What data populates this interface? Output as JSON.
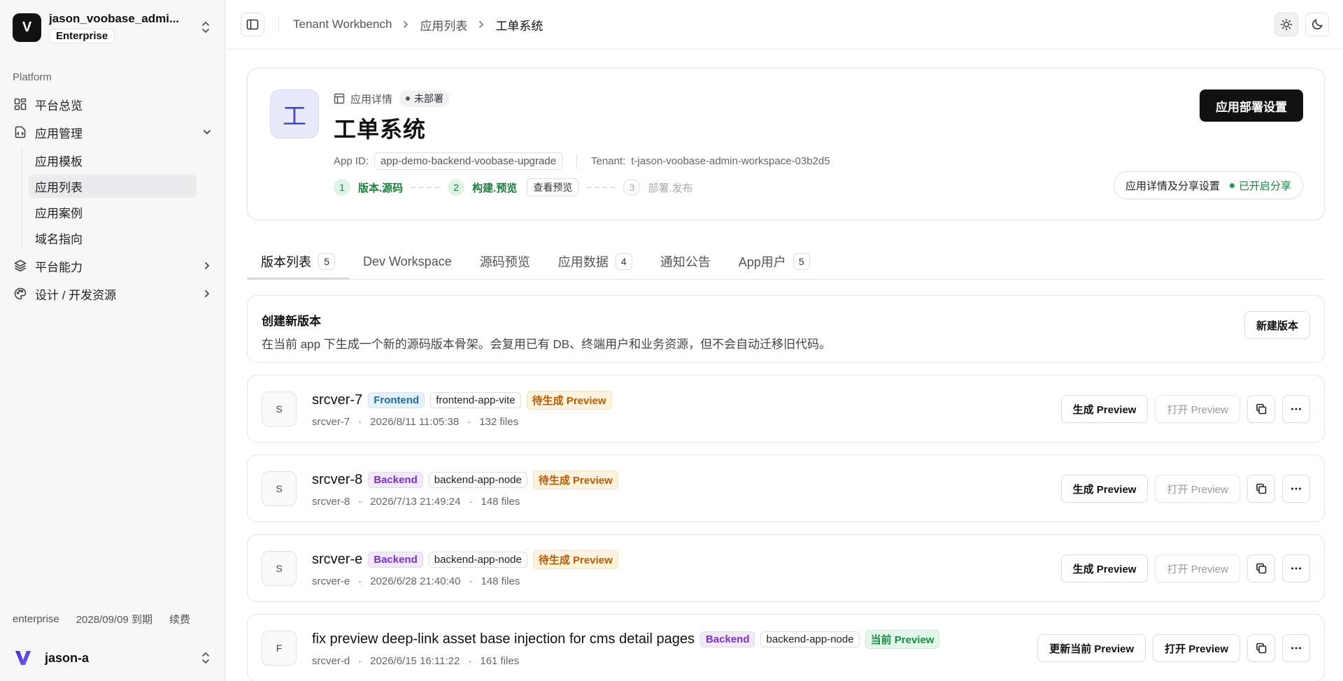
{
  "workspace": {
    "initial": "V",
    "name": "jason_voobase_admi...",
    "plan": "Enterprise"
  },
  "sidebar": {
    "section": "Platform",
    "items": [
      {
        "label": "平台总览",
        "icon": "dashboard-icon"
      },
      {
        "label": "应用管理",
        "icon": "app-manage-icon",
        "expanded": true,
        "children": [
          "应用模板",
          "应用列表",
          "应用案例",
          "域名指向"
        ],
        "active_child": "应用列表"
      },
      {
        "label": "平台能力",
        "icon": "layers-icon"
      },
      {
        "label": "设计 / 开发资源",
        "icon": "palette-icon"
      }
    ],
    "license": {
      "edition": "enterprise",
      "expiry": "2028/09/09 到期",
      "renew": "续费"
    },
    "user": {
      "name": "jason-a"
    }
  },
  "breadcrumb": [
    "Tenant Workbench",
    "应用列表",
    "工单系统"
  ],
  "app": {
    "avatar": "工",
    "meta_label": "应用详情",
    "status": "未部署",
    "title": "工单系统",
    "app_id_label": "App ID:",
    "app_id": "app-demo-backend-voobase-upgrade",
    "tenant_label": "Tenant:",
    "tenant": "t-jason-voobase-admin-workspace-03b2d5",
    "steps": [
      {
        "num": "1",
        "label": "版本.源码",
        "state": "done"
      },
      {
        "num": "2",
        "label": "构建.预览",
        "state": "done"
      },
      {
        "num": "3",
        "label": "部署.发布",
        "state": "todo"
      }
    ],
    "view_preview": "查看预览",
    "deploy_settings": "应用部署设置",
    "share_settings": "应用详情及分享设置",
    "share_status": "已开启分享"
  },
  "tabs": [
    {
      "label": "版本列表",
      "count": "5",
      "active": true
    },
    {
      "label": "Dev Workspace"
    },
    {
      "label": "源码预览"
    },
    {
      "label": "应用数据",
      "count": "4"
    },
    {
      "label": "通知公告"
    },
    {
      "label": "App用户",
      "count": "5"
    }
  ],
  "create": {
    "title": "创建新版本",
    "desc": "在当前 app 下生成一个新的源码版本骨架。会复用已有 DB、终端用户和业务资源，但不会自动迁移旧代码。",
    "button": "新建版本"
  },
  "versions": [
    {
      "avatar": "S",
      "name": "srcver-7",
      "type": "Frontend",
      "template": "frontend-app-vite",
      "preview": "待生成 Preview",
      "id": "srcver-7",
      "time": "2026/8/11 11:05:38",
      "files": "132 files",
      "primary": "生成 Preview",
      "secondary": "打开 Preview"
    },
    {
      "avatar": "S",
      "name": "srcver-8",
      "type": "Backend",
      "template": "backend-app-node",
      "preview": "待生成 Preview",
      "id": "srcver-8",
      "time": "2026/7/13 21:49:24",
      "files": "148 files",
      "primary": "生成 Preview",
      "secondary": "打开 Preview"
    },
    {
      "avatar": "S",
      "name": "srcver-e",
      "type": "Backend",
      "template": "backend-app-node",
      "preview": "待生成 Preview",
      "id": "srcver-e",
      "time": "2026/6/28 21:40:40",
      "files": "148 files",
      "primary": "生成 Preview",
      "secondary": "打开 Preview"
    },
    {
      "avatar": "F",
      "name": "fix preview deep-link asset base injection for cms detail pages",
      "type": "Backend",
      "template": "backend-app-node",
      "preview": "当前 Preview",
      "id": "srcver-d",
      "time": "2026/6/15 16:11:22",
      "files": "161 files",
      "primary": "更新当前 Preview",
      "secondary": "打开 Preview"
    }
  ]
}
